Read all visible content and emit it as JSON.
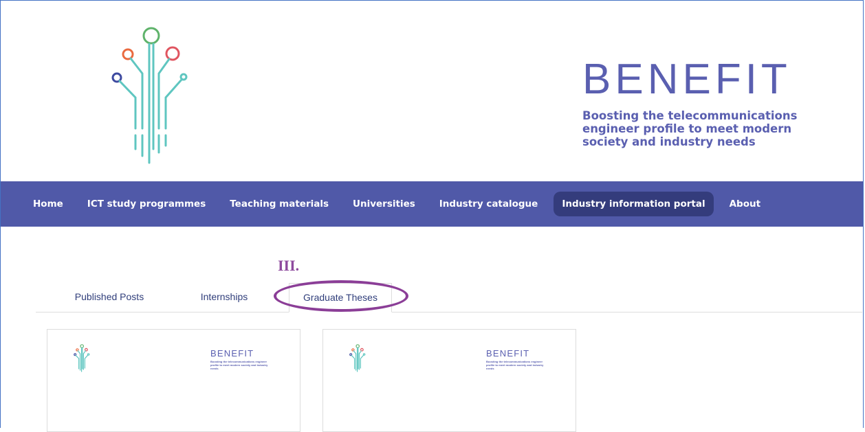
{
  "brand": {
    "title": "BENEFIT",
    "tagline": "Boosting the telecommunications engineer profile to meet modern society and industry needs",
    "color": "#5a5fb0",
    "logo_icon": "circuit-tree-logo-icon"
  },
  "nav": {
    "background": "#5059a8",
    "items": [
      {
        "label": "Home",
        "active": false
      },
      {
        "label": "ICT study programmes",
        "active": false
      },
      {
        "label": "Teaching materials",
        "active": false
      },
      {
        "label": "Universities",
        "active": false
      },
      {
        "label": "Industry catalogue",
        "active": false
      },
      {
        "label": "Industry information portal",
        "active": true
      },
      {
        "label": "About",
        "active": false
      }
    ]
  },
  "annotation": {
    "label": "III.",
    "color": "#8b3e97"
  },
  "tabs": {
    "items": [
      {
        "label": "Published Posts",
        "active": false
      },
      {
        "label": "Internships",
        "active": false
      },
      {
        "label": "Graduate Theses",
        "active": true
      }
    ]
  },
  "cards": [
    {
      "brand_title": "BENEFIT",
      "brand_tagline": "Boosting the telecommunications engineer profile to meet modern society and industry needs"
    },
    {
      "brand_title": "BENEFIT",
      "brand_tagline": "Boosting the telecommunications engineer profile to meet modern society and industry needs"
    }
  ]
}
